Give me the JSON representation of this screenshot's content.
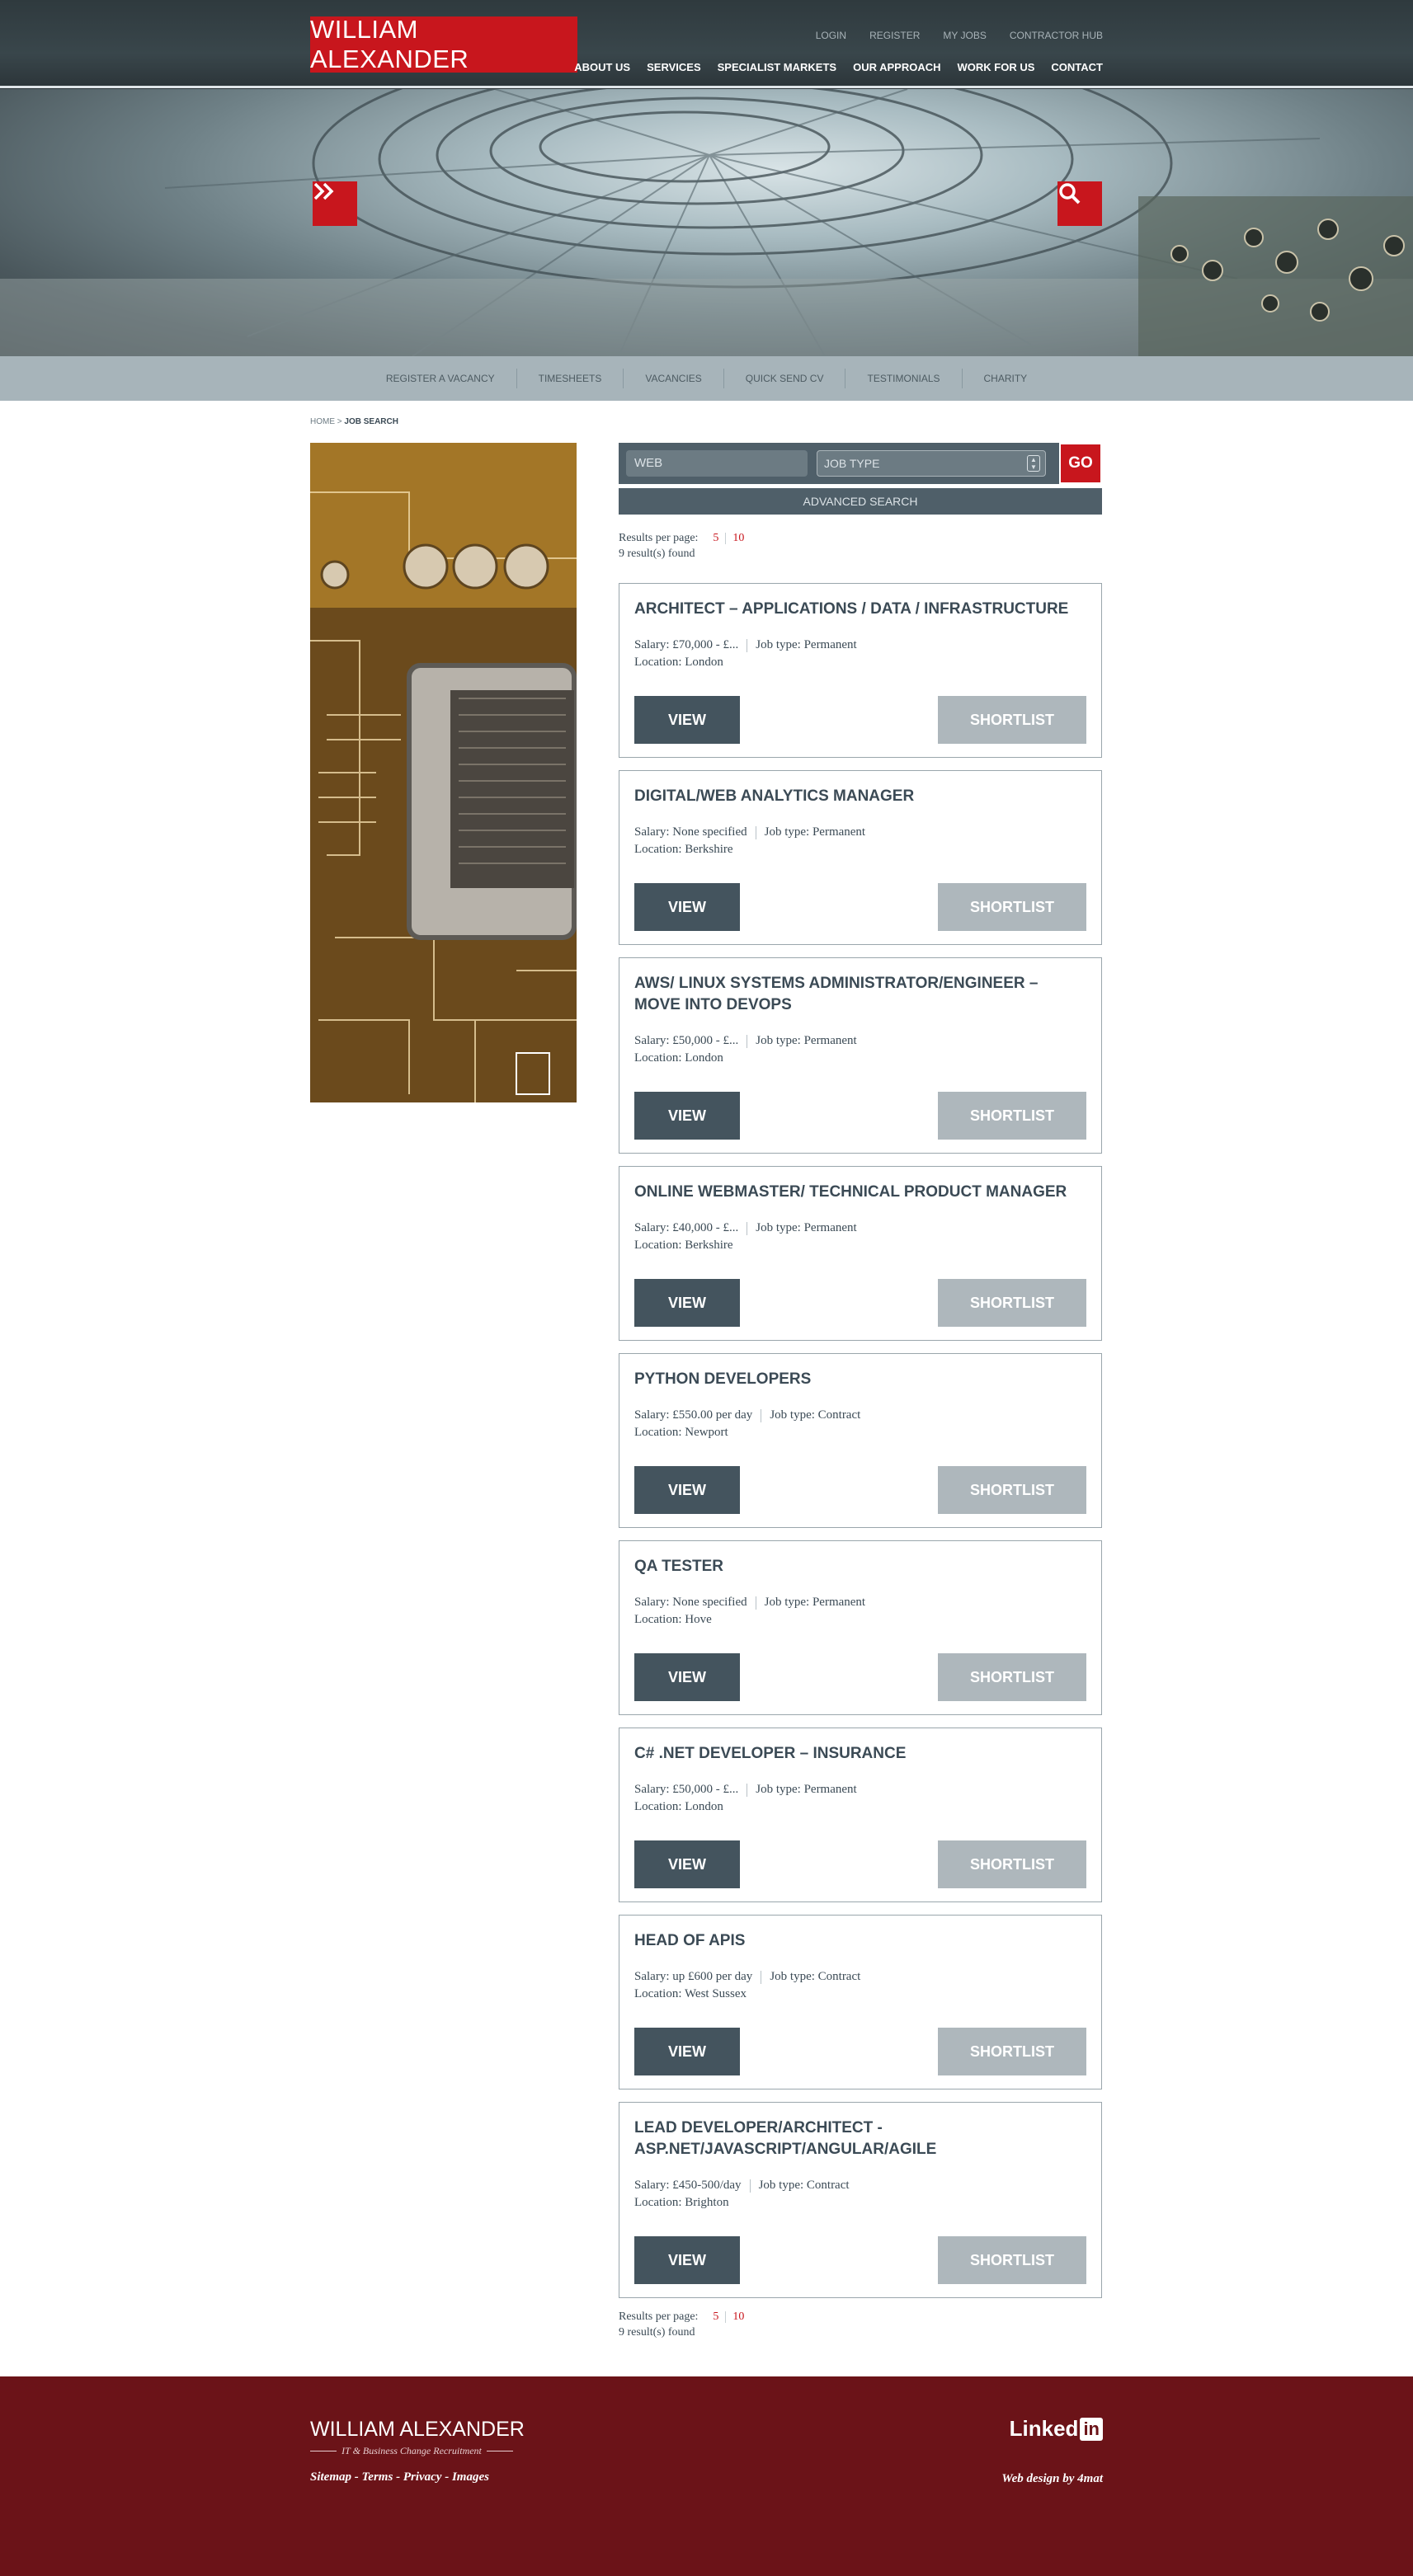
{
  "brand": {
    "logo_text": "WILLIAM ALEXANDER",
    "accent": "#c8161d",
    "dark": "#44545e"
  },
  "top_links": [
    "LOGIN",
    "REGISTER",
    "MY JOBS",
    "CONTRACTOR HUB"
  ],
  "main_nav": [
    "ABOUT US",
    "SERVICES",
    "SPECIALIST MARKETS",
    "OUR APPROACH",
    "WORK FOR US",
    "CONTACT"
  ],
  "hero": {
    "menu_icon": "double-chevron-right-icon",
    "search_icon": "search-icon"
  },
  "sub_nav": [
    "REGISTER A VACANCY",
    "TIMESHEETS",
    "VACANCIES",
    "QUICK SEND CV",
    "TESTIMONIALS",
    "CHARITY"
  ],
  "breadcrumb": {
    "home": "HOME",
    "separator": " > ",
    "current": "JOB SEARCH"
  },
  "search": {
    "keyword_value": "WEB",
    "job_type_value": "JOB TYPE",
    "go_label": "GO",
    "advanced_label": "ADVANCED SEARCH"
  },
  "results": {
    "per_page_label": "Results per page:",
    "per_page_options": [
      "5",
      "10"
    ],
    "count_text": "9 result(s) found"
  },
  "job_labels": {
    "view": "VIEW",
    "shortlist": "SHORTLIST"
  },
  "jobs": [
    {
      "title": "ARCHITECT – APPLICATIONS / DATA / INFRASTRUCTURE",
      "salary": "Salary: £70,000 - £...",
      "job_type": "Job type: Permanent",
      "location": "Location: London"
    },
    {
      "title": "DIGITAL/WEB ANALYTICS MANAGER",
      "salary": "Salary: None specified",
      "job_type": "Job type: Permanent",
      "location": "Location: Berkshire"
    },
    {
      "title": "AWS/ LINUX SYSTEMS ADMINISTRATOR/ENGINEER – MOVE INTO DEVOPS",
      "salary": "Salary: £50,000 - £...",
      "job_type": "Job type: Permanent",
      "location": "Location: London"
    },
    {
      "title": "ONLINE WEBMASTER/ TECHNICAL PRODUCT MANAGER",
      "salary": "Salary: £40,000 - £...",
      "job_type": "Job type: Permanent",
      "location": "Location: Berkshire"
    },
    {
      "title": "PYTHON DEVELOPERS",
      "salary": "Salary: £550.00 per day",
      "job_type": "Job type: Contract",
      "location": "Location: Newport"
    },
    {
      "title": "QA TESTER",
      "salary": "Salary: None specified",
      "job_type": "Job type: Permanent",
      "location": "Location: Hove"
    },
    {
      "title": "C# .NET DEVELOPER – INSURANCE",
      "salary": "Salary: £50,000 - £...",
      "job_type": "Job type: Permanent",
      "location": "Location: London"
    },
    {
      "title": "HEAD OF APIS",
      "salary": "Salary: up £600 per day",
      "job_type": "Job type: Contract",
      "location": "Location: West Sussex"
    },
    {
      "title": "LEAD DEVELOPER/ARCHITECT - ASP.NET/JAVASCRIPT/ANGULAR/AGILE",
      "salary": "Salary: £450-500/day",
      "job_type": "Job type: Contract",
      "location": "Location: Brighton"
    }
  ],
  "footer": {
    "logo_text": "WILLIAM ALEXANDER",
    "tagline": "IT & Business Change Recruitment",
    "links": [
      "Sitemap",
      "Terms",
      "Privacy",
      "Images"
    ],
    "link_separator": " - ",
    "social": {
      "word": "Linked",
      "badge": "in"
    },
    "credit": "Web design by 4mat"
  }
}
